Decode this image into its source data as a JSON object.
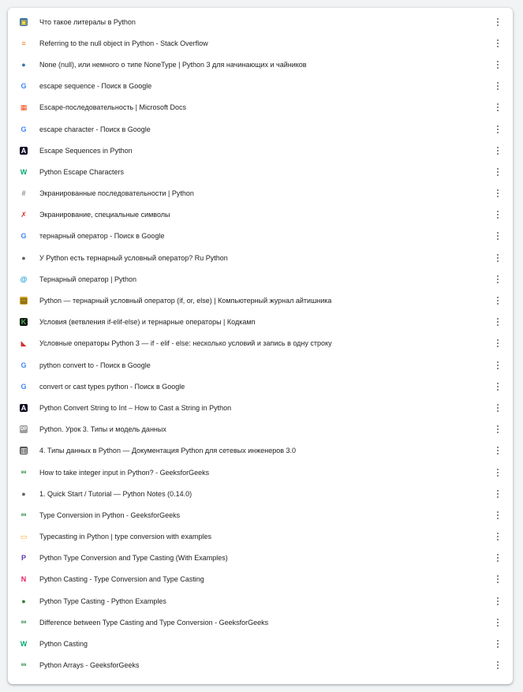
{
  "history": {
    "items": [
      {
        "title": "Что такое литералы в Python",
        "icon": "python-site-icon",
        "icon_glyph": "▣",
        "icon_bg": "#3a6ea5",
        "icon_fg": "#ffd43b"
      },
      {
        "title": "Referring to the null object in Python - Stack Overflow",
        "icon": "stackoverflow-icon",
        "icon_glyph": "≡",
        "icon_bg": "#ffffff",
        "icon_fg": "#f48024"
      },
      {
        "title": "None (null), или немного о типе NoneType | Python 3 для начинающих и чайников",
        "icon": "python-logo-icon",
        "icon_glyph": "●",
        "icon_bg": "#ffffff",
        "icon_fg": "#3776ab"
      },
      {
        "title": "escape sequence - Поиск в Google",
        "icon": "google-icon",
        "icon_glyph": "G",
        "icon_bg": "#ffffff",
        "icon_fg": "#4285f4"
      },
      {
        "title": "Escape-последовательность | Microsoft Docs",
        "icon": "microsoft-icon",
        "icon_glyph": "▦",
        "icon_bg": "#ffffff",
        "icon_fg": "#f25022"
      },
      {
        "title": "escape character - Поиск в Google",
        "icon": "google-icon",
        "icon_glyph": "G",
        "icon_bg": "#ffffff",
        "icon_fg": "#4285f4"
      },
      {
        "title": "Escape Sequences in Python",
        "icon": "freecodecamp-icon",
        "icon_glyph": "A",
        "icon_bg": "#0a0a23",
        "icon_fg": "#ffffff"
      },
      {
        "title": "Python Escape Characters",
        "icon": "w3schools-icon",
        "icon_glyph": "W",
        "icon_bg": "#ffffff",
        "icon_fg": "#04aa6d"
      },
      {
        "title": "Экранированные последовательности | Python",
        "icon": "hash-icon",
        "icon_glyph": "#",
        "icon_bg": "#ffffff",
        "icon_fg": "#888888"
      },
      {
        "title": "Экранирование, специальные символы",
        "icon": "pythonworld-icon",
        "icon_glyph": "✗",
        "icon_bg": "#ffffff",
        "icon_fg": "#d93025"
      },
      {
        "title": "тернарный оператор - Поиск в Google",
        "icon": "google-icon",
        "icon_glyph": "G",
        "icon_bg": "#ffffff",
        "icon_fg": "#4285f4"
      },
      {
        "title": "У Python есть тернарный условный оператор? Ru Python",
        "icon": "globe-icon",
        "icon_glyph": "●",
        "icon_bg": "#ffffff",
        "icon_fg": "#5f6368"
      },
      {
        "title": "Тернарный оператор | Python",
        "icon": "metanit-icon",
        "icon_glyph": "@",
        "icon_bg": "#ffffff",
        "icon_fg": "#1a9fd8"
      },
      {
        "title": "Python — тернарный условный оператор (if, or, else) | Компьютерный журнал айтишника",
        "icon": "notebook-icon",
        "icon_glyph": "▤",
        "icon_bg": "#c9a227",
        "icon_fg": "#5a4300"
      },
      {
        "title": "Условия (ветвления if-elif-else) и тернарные операторы | Кодкамп",
        "icon": "kodkamp-icon",
        "icon_glyph": "K",
        "icon_bg": "#111111",
        "icon_fg": "#4caf50"
      },
      {
        "title": "Условные операторы Python 3 — if - elif - else: несколько условий и запись в одну строку",
        "icon": "car-icon",
        "icon_glyph": "◣",
        "icon_bg": "#ffffff",
        "icon_fg": "#d32f2f"
      },
      {
        "title": "python convert to - Поиск в Google",
        "icon": "google-icon",
        "icon_glyph": "G",
        "icon_bg": "#ffffff",
        "icon_fg": "#4285f4"
      },
      {
        "title": "convert or cast types python - Поиск в Google",
        "icon": "google-icon",
        "icon_glyph": "G",
        "icon_bg": "#ffffff",
        "icon_fg": "#4285f4"
      },
      {
        "title": "Python Convert String to Int – How to Cast a String in Python",
        "icon": "freecodecamp-icon",
        "icon_glyph": "A",
        "icon_bg": "#0a0a23",
        "icon_fg": "#ffffff"
      },
      {
        "title": "Python. Урок 3. Типы и модель данных",
        "icon": "devpractice-icon",
        "icon_glyph": "DP",
        "icon_bg": "#9e9e9e",
        "icon_fg": "#ffffff"
      },
      {
        "title": "4. Типы данных в Python — Документация Python для сетевых инженеров 3.0",
        "icon": "book-icon",
        "icon_glyph": "▥",
        "icon_bg": "#555555",
        "icon_fg": "#ffffff"
      },
      {
        "title": "How to take integer input in Python? - GeeksforGeeks",
        "icon": "geeksforgeeks-icon",
        "icon_glyph": "ɞɘ",
        "icon_bg": "#ffffff",
        "icon_fg": "#2f8d46"
      },
      {
        "title": "1. Quick Start / Tutorial — Python Notes (0.14.0)",
        "icon": "globe-icon",
        "icon_glyph": "●",
        "icon_bg": "#ffffff",
        "icon_fg": "#5f6368"
      },
      {
        "title": "Type Conversion in Python - GeeksforGeeks",
        "icon": "geeksforgeeks-icon",
        "icon_glyph": "ɞɘ",
        "icon_bg": "#ffffff",
        "icon_fg": "#2f8d46"
      },
      {
        "title": "Typecasting in Python | type conversion with examples",
        "icon": "monitor-icon",
        "icon_glyph": "▭",
        "icon_bg": "#ffffff",
        "icon_fg": "#f5a623"
      },
      {
        "title": "Python Type Conversion and Type Casting (With Examples)",
        "icon": "programiz-icon",
        "icon_glyph": "P",
        "icon_bg": "#ffffff",
        "icon_fg": "#5e35b1"
      },
      {
        "title": "Python Casting - Type Conversion and Type Casting",
        "icon": "tutorialkart-icon",
        "icon_glyph": "N",
        "icon_bg": "#ffffff",
        "icon_fg": "#e91e63"
      },
      {
        "title": "Python Type Casting - Python Examples",
        "icon": "pythonexamples-icon",
        "icon_glyph": "●",
        "icon_bg": "#ffffff",
        "icon_fg": "#2e7d32"
      },
      {
        "title": "Difference between Type Casting and Type Conversion - GeeksforGeeks",
        "icon": "geeksforgeeks-icon",
        "icon_glyph": "ɞɘ",
        "icon_bg": "#ffffff",
        "icon_fg": "#2f8d46"
      },
      {
        "title": "Python Casting",
        "icon": "w3schools-icon",
        "icon_glyph": "W",
        "icon_bg": "#ffffff",
        "icon_fg": "#04aa6d"
      },
      {
        "title": "Python Arrays - GeeksforGeeks",
        "icon": "geeksforgeeks-icon",
        "icon_glyph": "ɞɘ",
        "icon_bg": "#ffffff",
        "icon_fg": "#2f8d46"
      }
    ]
  }
}
